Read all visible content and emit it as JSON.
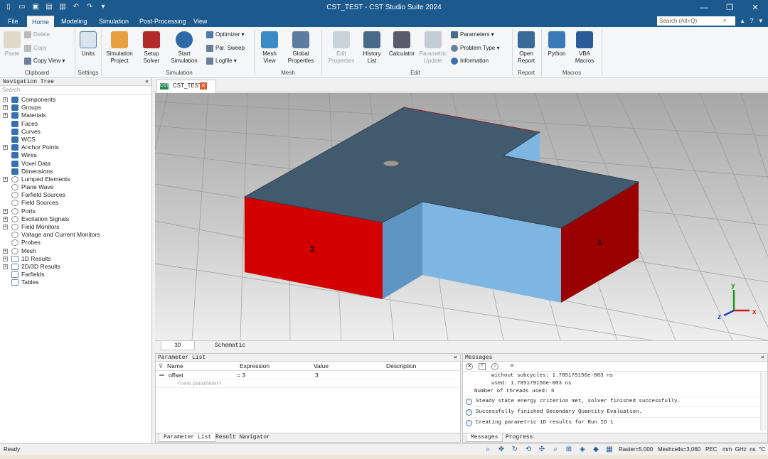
{
  "window": {
    "title": "CST_TEST - CST Studio Suite 2024",
    "quick_access_icons": [
      "new-file-icon",
      "open-icon",
      "save-icon",
      "save-all-icon",
      "print-icon",
      "undo-icon",
      "redo-icon",
      "customize-icon"
    ],
    "controls": [
      "minimize-icon",
      "restore-icon",
      "close-icon"
    ]
  },
  "menu": {
    "tabs": [
      "File",
      "Home",
      "Modeling",
      "Simulation",
      "Post-Processing",
      "View"
    ],
    "active_tab": "Home",
    "search_placeholder": "Search (Alt+Q)"
  },
  "ribbon": {
    "clipboard": {
      "label": "Clipboard",
      "paste": "Paste",
      "delete": "Delete",
      "copy": "Copy",
      "copy_view": "Copy View"
    },
    "settings": {
      "label": "Settings",
      "units": "Units"
    },
    "simulation": {
      "label": "Simulation",
      "simulation_project": "Simulation\nProject",
      "setup_solver": "Setup\nSolver",
      "start_simulation": "Start\nSimulation",
      "optimizer": "Optimizer",
      "par_sweep": "Par. Sweep",
      "logfile": "Logfile"
    },
    "mesh": {
      "label": "Mesh",
      "mesh_view": "Mesh\nView",
      "global_properties": "Global\nProperties"
    },
    "edit": {
      "label": "Edit",
      "edit_properties": "Edit\nProperties",
      "history_list": "History\nList",
      "calculator": "Calculator",
      "parametric_update": "Parametric\nUpdate",
      "parameters": "Parameters",
      "problem_type": "Problem Type",
      "information": "Information"
    },
    "report": {
      "label": "Report",
      "open_report": "Open\nReport"
    },
    "macros": {
      "label": "Macros",
      "python": "Python",
      "vba_macros": "VBA\nMacros"
    }
  },
  "nav_tree": {
    "title": "Navigation Tree",
    "search_placeholder": "Search",
    "items": [
      {
        "label": "Components",
        "expandable": true,
        "icon": "folder-blue"
      },
      {
        "label": "Groups",
        "expandable": true,
        "icon": "folder-blue"
      },
      {
        "label": "Materials",
        "expandable": true,
        "icon": "folder-blue"
      },
      {
        "label": "Faces",
        "expandable": false,
        "icon": "folder-blue"
      },
      {
        "label": "Curves",
        "expandable": false,
        "icon": "folder-blue"
      },
      {
        "label": "WCS",
        "expandable": false,
        "icon": "folder-blue"
      },
      {
        "label": "Anchor Points",
        "expandable": true,
        "icon": "folder-blue"
      },
      {
        "label": "Wires",
        "expandable": false,
        "icon": "folder-blue"
      },
      {
        "label": "Voxel Data",
        "expandable": false,
        "icon": "folder-blue"
      },
      {
        "label": "Dimensions",
        "expandable": false,
        "icon": "folder-blue"
      },
      {
        "label": "Lumped Elements",
        "expandable": true,
        "icon": "folder-gray"
      },
      {
        "label": "Plane Wave",
        "expandable": false,
        "icon": "folder-gray"
      },
      {
        "label": "Farfield Sources",
        "expandable": false,
        "icon": "folder-gray"
      },
      {
        "label": "Field Sources",
        "expandable": false,
        "icon": "folder-gray"
      },
      {
        "label": "Ports",
        "expandable": true,
        "icon": "folder-gray"
      },
      {
        "label": "Excitation Signals",
        "expandable": true,
        "icon": "folder-gray"
      },
      {
        "label": "Field Monitors",
        "expandable": true,
        "icon": "folder-gray"
      },
      {
        "label": "Voltage and Current Monitors",
        "expandable": false,
        "icon": "folder-gray"
      },
      {
        "label": "Probes",
        "expandable": false,
        "icon": "folder-gray"
      },
      {
        "label": "Mesh",
        "expandable": true,
        "icon": "folder-gray"
      },
      {
        "label": "1D Results",
        "expandable": true,
        "icon": "results"
      },
      {
        "label": "2D/3D Results",
        "expandable": true,
        "icon": "results"
      },
      {
        "label": "Farfields",
        "expandable": false,
        "icon": "results"
      },
      {
        "label": "Tables",
        "expandable": false,
        "icon": "results"
      }
    ]
  },
  "document_tab": {
    "label": "CST_TEST",
    "icon_text": "CST"
  },
  "viewport": {
    "port_labels": [
      "2",
      "1"
    ],
    "axes": [
      "x",
      "y",
      "z"
    ],
    "colors": {
      "top": "#425a6e",
      "port": "#d20000",
      "port_dark": "#9b0000",
      "side": "#7db5e3",
      "side_dark": "#5f95c3"
    }
  },
  "view_tabs": [
    "3D",
    "Schematic"
  ],
  "parameter_list": {
    "title": "Parameter List",
    "columns": [
      "Name",
      "Expression",
      "Value",
      "Description"
    ],
    "rows": [
      {
        "name": "offset",
        "expression": "= 3",
        "value": "3",
        "description": ""
      }
    ],
    "new_placeholder": "<new parameter>",
    "tabs": [
      "Parameter List",
      "Result Navigator"
    ]
  },
  "messages": {
    "title": "Messages",
    "log_lines": [
      "without subcycles: 1.785179156e-003 ns",
      "used: 1.785179156e-003 ns",
      "Number of threads used: 6"
    ],
    "info_messages": [
      "Steady state energy criterion met, solver finished successfully.",
      "Successfully finished Secondary Quantity Evaluation.",
      "Creating parametric 1D results for Run ID 1"
    ],
    "tabs": [
      "Messages",
      "Progress"
    ]
  },
  "status": {
    "ready": "Ready",
    "raster": "Raster=5.000",
    "meshcells": "Meshcells=3,060",
    "boundary": "PEC",
    "units": "mm  GHz  ns  °C"
  }
}
